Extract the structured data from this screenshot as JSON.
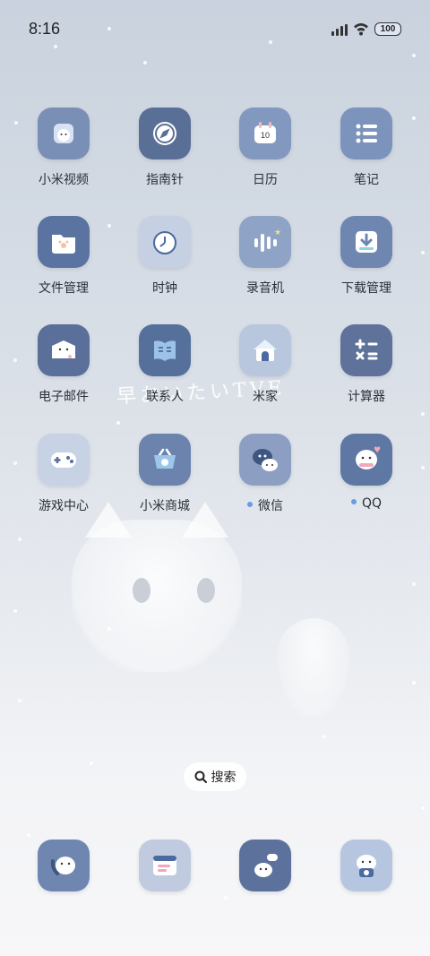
{
  "status_bar": {
    "time": "8:16",
    "battery": "100"
  },
  "wallpaper": {
    "handwriting": "早おいたいTVE"
  },
  "apps": [
    {
      "label": "小米视频",
      "icon": "video-cat-icon",
      "color": "#7a8fb5",
      "dot": false
    },
    {
      "label": "指南针",
      "icon": "compass-icon",
      "color": "#5a6f96",
      "dot": false
    },
    {
      "label": "日历",
      "icon": "calendar-cat-icon",
      "color": "#8298bf",
      "dot": false,
      "icon_text": "10"
    },
    {
      "label": "笔记",
      "icon": "notes-list-icon",
      "color": "#7c93bc",
      "dot": false
    },
    {
      "label": "文件管理",
      "icon": "folder-paw-icon",
      "color": "#5b73a0",
      "dot": false
    },
    {
      "label": "时钟",
      "icon": "clock-cat-icon",
      "color": "#c5d0e3",
      "dot": false
    },
    {
      "label": "录音机",
      "icon": "recorder-bars-icon",
      "color": "#8fa3c6",
      "dot": false
    },
    {
      "label": "下载管理",
      "icon": "download-icon",
      "color": "#6f86b0",
      "dot": false
    },
    {
      "label": "电子邮件",
      "icon": "mail-cat-icon",
      "color": "#5a6f99",
      "dot": false
    },
    {
      "label": "联系人",
      "icon": "contacts-book-icon",
      "color": "#56709c",
      "dot": false
    },
    {
      "label": "米家",
      "icon": "home-house-icon",
      "color": "#b9c7de",
      "dot": false
    },
    {
      "label": "计算器",
      "icon": "calculator-icon",
      "color": "#5e729a",
      "dot": false
    },
    {
      "label": "游戏中心",
      "icon": "gamepad-icon",
      "color": "#c7d2e5",
      "dot": false
    },
    {
      "label": "小米商城",
      "icon": "shopping-basket-icon",
      "color": "#6c84ad",
      "dot": false
    },
    {
      "label": "微信",
      "icon": "wechat-cat-icon",
      "color": "#8c9fc3",
      "dot": true
    },
    {
      "label": "QQ",
      "icon": "qq-cat-icon",
      "color": "#5e77a3",
      "dot": true
    }
  ],
  "search": {
    "label": "搜索"
  },
  "dock": [
    {
      "icon": "phone-cat-icon",
      "color": "#6e86b0"
    },
    {
      "icon": "messages-window-icon",
      "color": "#c0cbe0"
    },
    {
      "icon": "chat-cat-icon",
      "color": "#5c729c"
    },
    {
      "icon": "camera-cat-icon",
      "color": "#b7c6e0"
    }
  ]
}
